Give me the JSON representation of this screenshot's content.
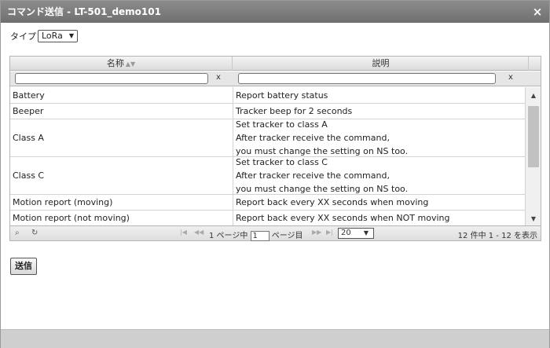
{
  "window": {
    "title": "コマンド送信 - LT-501_demo101",
    "close_glyph": "×"
  },
  "type_selector": {
    "label": "タイプ",
    "value": "LoRa"
  },
  "grid": {
    "columns": [
      "名称",
      "説明"
    ],
    "clear_glyph": "x",
    "rows": [
      {
        "name": "Battery",
        "desc": [
          "Report battery status"
        ]
      },
      {
        "name": "Beeper",
        "desc": [
          "Tracker beep for 2 seconds"
        ]
      },
      {
        "name": "Class A",
        "desc": [
          "Set tracker to class A",
          "After tracker receive the command,",
          "you must change the setting on NS too."
        ]
      },
      {
        "name": "Class C",
        "desc": [
          "Set tracker to class C",
          "After tracker receive the command,",
          "you must change the setting on NS too."
        ]
      },
      {
        "name": "Motion report (moving)",
        "desc": [
          "Report back every XX seconds when moving"
        ]
      },
      {
        "name": "Motion report (not moving)",
        "desc": [
          "Report back every XX seconds when NOT moving"
        ]
      }
    ],
    "pager": {
      "page_prefix": "1 ページ中",
      "page_value": "1",
      "page_suffix": "ページ目",
      "page_size": "20",
      "info": "12 件中 1 - 12 を表示"
    }
  },
  "send_button": "送信",
  "icons": {
    "sort": "sort-icon",
    "search": "search-icon",
    "refresh": "refresh-icon",
    "first": "first-page-icon",
    "prev": "prev-page-icon",
    "next": "next-page-icon",
    "last": "last-page-icon"
  },
  "colors": {
    "titlebar": "#7a7a7a",
    "footer": "#cfcfcf"
  }
}
